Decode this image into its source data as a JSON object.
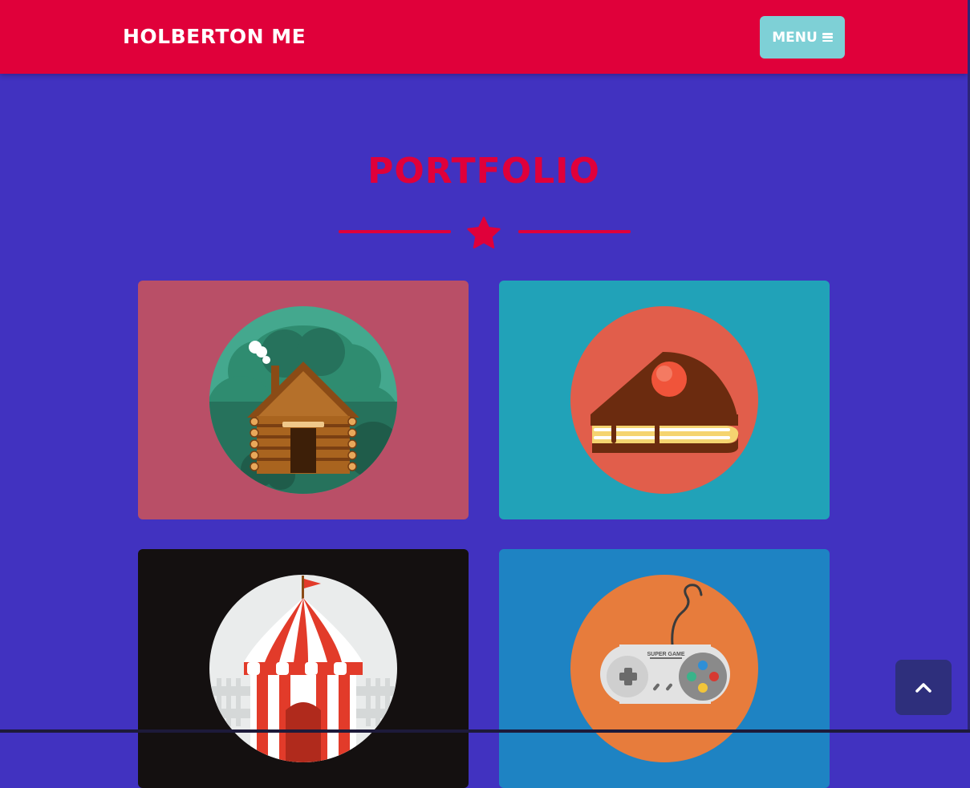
{
  "navbar": {
    "brand": "HOLBERTON ME",
    "menu_label": "MENU",
    "menu_icon": "bars-icon"
  },
  "portfolio": {
    "title": "PORTFOLIO",
    "divider_icon": "star-icon",
    "items": [
      {
        "subject": "log cabin",
        "background": "#b94f67",
        "circle": "#44a88e"
      },
      {
        "subject": "cake slice",
        "background": "#21a2b8",
        "circle": "#e15e4b"
      },
      {
        "subject": "circus tent",
        "background": "#141010",
        "circle": "#eaecec"
      },
      {
        "subject": "game controller",
        "subtext": "SUPER GAME",
        "background": "#1e83c3",
        "circle": "#e77c3c"
      }
    ]
  },
  "scroll_top": {
    "icon": "chevron-up-icon"
  },
  "colors": {
    "navbar": "#e0003a",
    "page_background": "#4132c0",
    "accent": "#e0003a",
    "menu_button": "#7ed0d6",
    "scroll_top_button": "#2e2f7c"
  }
}
